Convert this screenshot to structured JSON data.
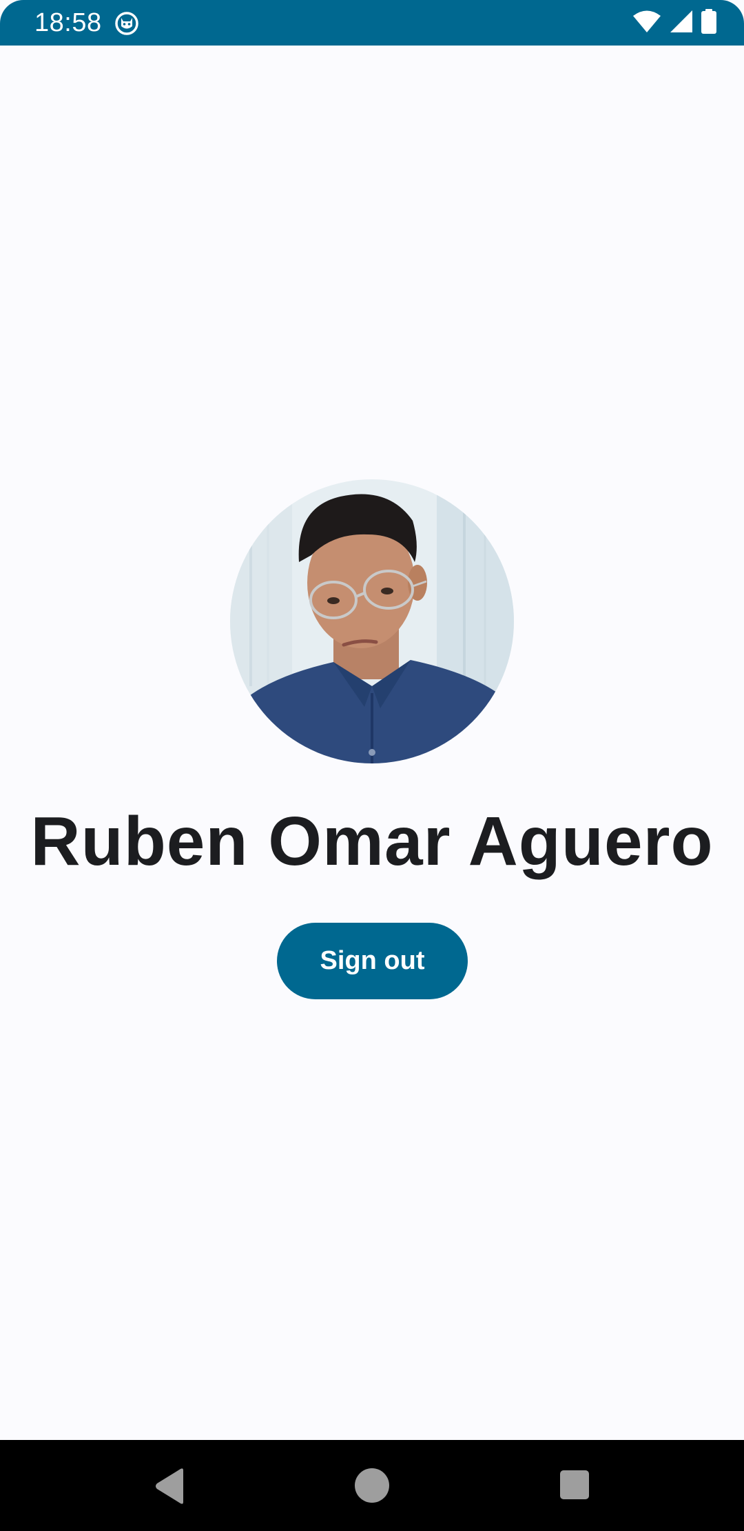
{
  "status_bar": {
    "time": "18:58",
    "app_icon": "cat-face-icon",
    "background_color": "#006890",
    "icons": [
      "wifi-icon",
      "cellular-signal-icon",
      "battery-icon"
    ]
  },
  "profile": {
    "avatar": "profile-photo",
    "name": "Ruben Omar Aguero"
  },
  "actions": {
    "sign_out_label": "Sign out",
    "button_color": "#006890"
  },
  "navigation_bar": {
    "buttons": [
      "back-icon",
      "home-icon",
      "recents-icon"
    ]
  }
}
